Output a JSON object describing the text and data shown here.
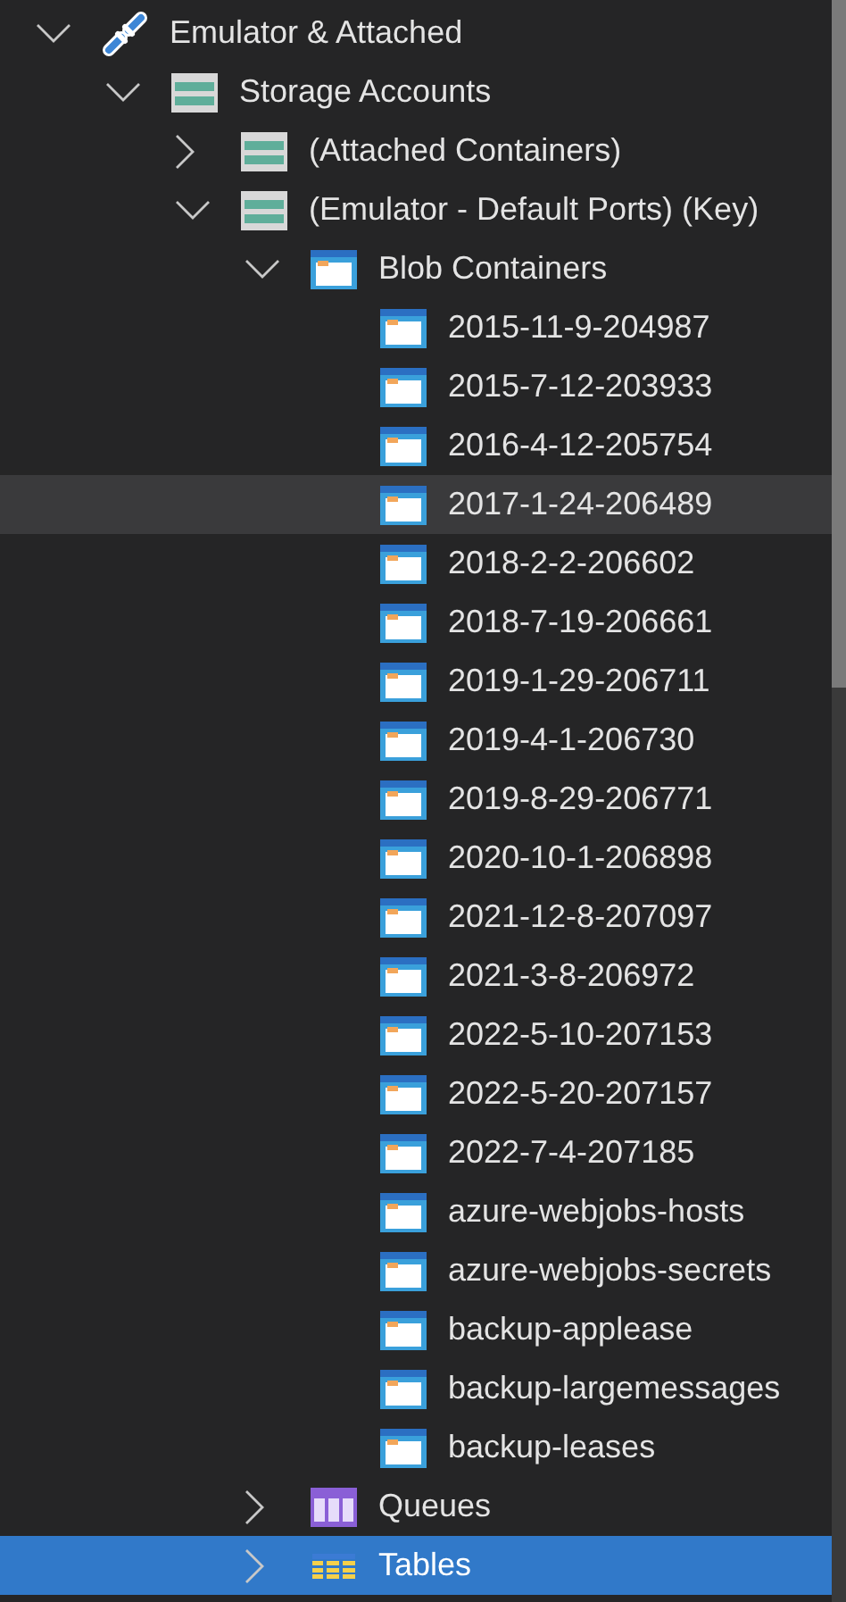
{
  "tree": [
    {
      "label": "Emulator & Attached",
      "kind": "link",
      "expanded": true,
      "selected": false,
      "hovered": false,
      "children": [
        {
          "label": "Storage Accounts",
          "kind": "storage",
          "expanded": true,
          "selected": false,
          "hovered": false,
          "children": [
            {
              "label": "(Attached Containers)",
              "kind": "storage",
              "expanded": false,
              "selected": false,
              "hovered": false
            },
            {
              "label": "(Emulator - Default Ports) (Key)",
              "kind": "storage",
              "expanded": true,
              "selected": false,
              "hovered": false,
              "children": [
                {
                  "label": "Blob Containers",
                  "kind": "container",
                  "expanded": true,
                  "selected": false,
                  "hovered": false,
                  "children": [
                    {
                      "label": "2015-11-9-204987",
                      "kind": "container",
                      "selected": false,
                      "hovered": false
                    },
                    {
                      "label": "2015-7-12-203933",
                      "kind": "container",
                      "selected": false,
                      "hovered": false
                    },
                    {
                      "label": "2016-4-12-205754",
                      "kind": "container",
                      "selected": false,
                      "hovered": false
                    },
                    {
                      "label": "2017-1-24-206489",
                      "kind": "container",
                      "selected": false,
                      "hovered": true
                    },
                    {
                      "label": "2018-2-2-206602",
                      "kind": "container",
                      "selected": false,
                      "hovered": false
                    },
                    {
                      "label": "2018-7-19-206661",
                      "kind": "container",
                      "selected": false,
                      "hovered": false
                    },
                    {
                      "label": "2019-1-29-206711",
                      "kind": "container",
                      "selected": false,
                      "hovered": false
                    },
                    {
                      "label": "2019-4-1-206730",
                      "kind": "container",
                      "selected": false,
                      "hovered": false
                    },
                    {
                      "label": "2019-8-29-206771",
                      "kind": "container",
                      "selected": false,
                      "hovered": false
                    },
                    {
                      "label": "2020-10-1-206898",
                      "kind": "container",
                      "selected": false,
                      "hovered": false
                    },
                    {
                      "label": "2021-12-8-207097",
                      "kind": "container",
                      "selected": false,
                      "hovered": false
                    },
                    {
                      "label": "2021-3-8-206972",
                      "kind": "container",
                      "selected": false,
                      "hovered": false
                    },
                    {
                      "label": "2022-5-10-207153",
                      "kind": "container",
                      "selected": false,
                      "hovered": false
                    },
                    {
                      "label": "2022-5-20-207157",
                      "kind": "container",
                      "selected": false,
                      "hovered": false
                    },
                    {
                      "label": "2022-7-4-207185",
                      "kind": "container",
                      "selected": false,
                      "hovered": false
                    },
                    {
                      "label": "azure-webjobs-hosts",
                      "kind": "container",
                      "selected": false,
                      "hovered": false
                    },
                    {
                      "label": "azure-webjobs-secrets",
                      "kind": "container",
                      "selected": false,
                      "hovered": false
                    },
                    {
                      "label": "backup-applease",
                      "kind": "container",
                      "selected": false,
                      "hovered": false
                    },
                    {
                      "label": "backup-largemessages",
                      "kind": "container",
                      "selected": false,
                      "hovered": false
                    },
                    {
                      "label": "backup-leases",
                      "kind": "container",
                      "selected": false,
                      "hovered": false
                    }
                  ]
                },
                {
                  "label": "Queues",
                  "kind": "queue",
                  "expanded": false,
                  "selected": false,
                  "hovered": false
                },
                {
                  "label": "Tables",
                  "kind": "table",
                  "expanded": false,
                  "selected": true,
                  "hovered": false
                }
              ]
            }
          ]
        }
      ]
    }
  ]
}
